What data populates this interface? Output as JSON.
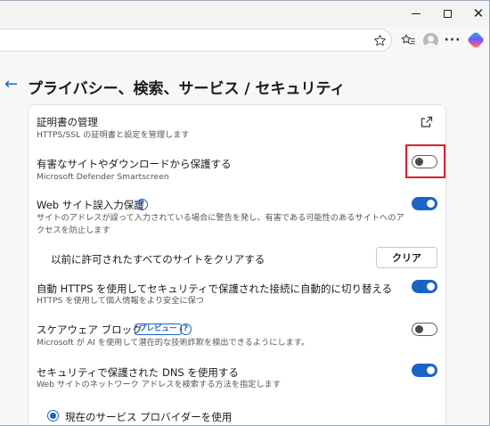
{
  "window": {
    "minimize_label": "",
    "maximize_label": "",
    "close_label": "✕"
  },
  "toolbar": {
    "address_value": "",
    "favorite_icon": "star-icon",
    "favorites_icon": "favorites-list-icon",
    "profile_icon": "profile-icon",
    "more_label": "···",
    "copilot_icon": "copilot-icon"
  },
  "page": {
    "back_label": "←",
    "title": "プライバシー、検索、サービス / セキュリティ"
  },
  "settings": {
    "certs": {
      "title": "証明書の管理",
      "desc": "HTTPS/SSL の証明書と設定を管理します"
    },
    "harmful": {
      "title": "有害なサイトやダウンロードから保護する",
      "desc": "Microsoft Defender Smartscreen",
      "enabled": false
    },
    "typo": {
      "title": "Web サイト誤入力保護",
      "help": "?",
      "desc": "サイトのアドレスが誤って入力されている場合に警告を発し、有害である可能性のあるサイトへのアクセスを防止します",
      "enabled": true
    },
    "clear_sites": {
      "title": "以前に許可されたすべてのサイトをクリアする",
      "button": "クリア"
    },
    "https": {
      "title": "自動 HTTPS を使用してセキュリティで保護された接続に自動的に切り替える",
      "desc": "HTTPS を使用して個人情報をより安全に保つ",
      "enabled": true
    },
    "scareware": {
      "title": "スケアウェア ブロック",
      "badge": "プレビュー",
      "help": "?",
      "desc": "Microsoft が AI を使用して潜在的な技術詐欺を検出できるようにします。",
      "enabled": false
    },
    "dns": {
      "title": "セキュリティで保護された DNS を使用する",
      "desc": "Web サイトのネットワーク アドレスを検索する方法を指定します",
      "enabled": true
    },
    "dns_provider": {
      "label": "現在のサービス プロバイダーを使用",
      "selected": true
    }
  },
  "colors": {
    "accent": "#1a63c8",
    "highlight": "#e0202a"
  }
}
